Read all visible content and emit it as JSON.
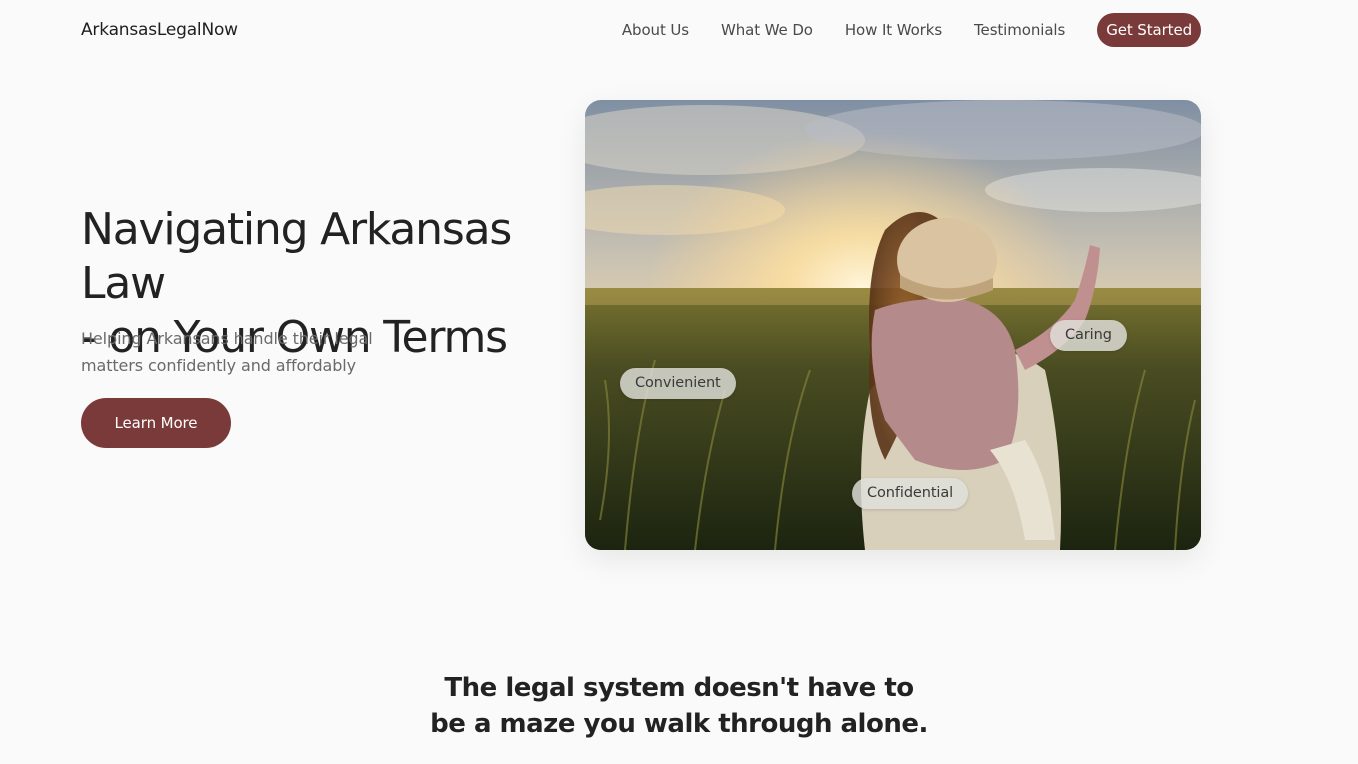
{
  "nav": {
    "brand": "ArkansasLegalNow",
    "links": [
      "About Us",
      "What We Do",
      "How It Works",
      "Testimonials"
    ],
    "cta": "Get Started"
  },
  "hero": {
    "title_line1": "Navigating Arkansas Law",
    "title_line2": "- on Your Own Terms",
    "subtitle_line1": "Helping Arkansans handle their legal",
    "subtitle_line2": "matters confidently and affordably",
    "button": "Learn More",
    "tags": [
      "Convienient",
      "Caring",
      "Confidential"
    ]
  },
  "tagline": {
    "line1": "The legal system doesn't have to",
    "line2": "be a maze you walk through alone."
  },
  "colors": {
    "accent": "#7a3a3a",
    "background": "#fafafa"
  }
}
